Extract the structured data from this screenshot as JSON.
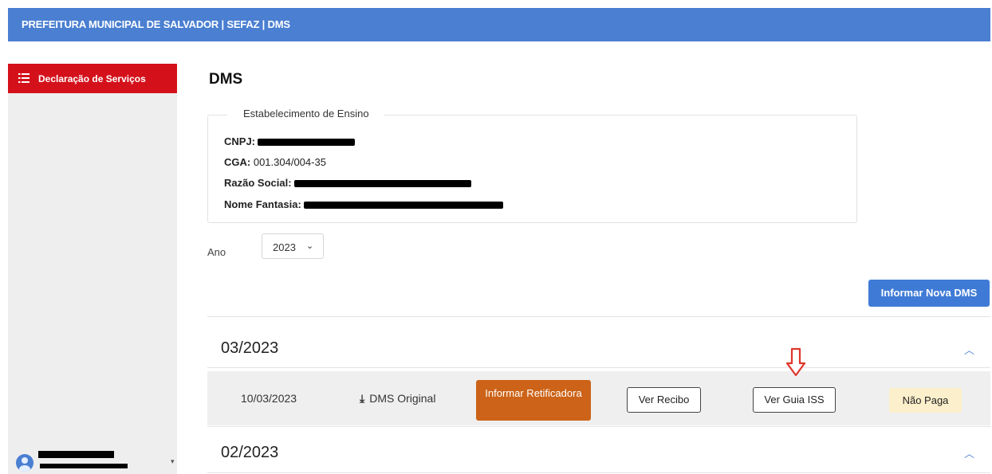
{
  "header": {
    "title": "PREFEITURA MUNICIPAL DE SALVADOR | SEFAZ | DMS"
  },
  "sidebar": {
    "items": [
      {
        "label": "Declaração de Serviços",
        "icon": "list-icon"
      }
    ],
    "user": {
      "icon": "user-avatar-icon"
    }
  },
  "main": {
    "title": "DMS",
    "establishment": {
      "legend": "Estabelecimento de Ensino",
      "cnpj_label": "CNPJ:",
      "cga_label": "CGA:",
      "cga_value": "001.304/004-35",
      "razao_label": "Razão Social:",
      "fantasia_label": "Nome Fantasia:"
    },
    "year_label": "Ano",
    "year_value": "2023",
    "new_dms_button": "Informar Nova DMS",
    "periods": [
      {
        "label": "03/2023",
        "expanded": true,
        "entries": [
          {
            "date": "10/03/2023",
            "download_label": "DMS Original",
            "retif_button": "Informar Retificadora",
            "recibo_button": "Ver Recibo",
            "guia_button": "Ver Guia ISS",
            "status": "Não Paga"
          }
        ]
      },
      {
        "label": "02/2023",
        "expanded": true
      }
    ]
  },
  "colors": {
    "topbar": "#4a7fd1",
    "sidebar_active": "#d4111b",
    "primary_button": "#3f7bd6",
    "retif_button": "#cc6318",
    "status_unpaid_bg": "#fcefcb",
    "annotation_arrow": "#e0362c"
  }
}
